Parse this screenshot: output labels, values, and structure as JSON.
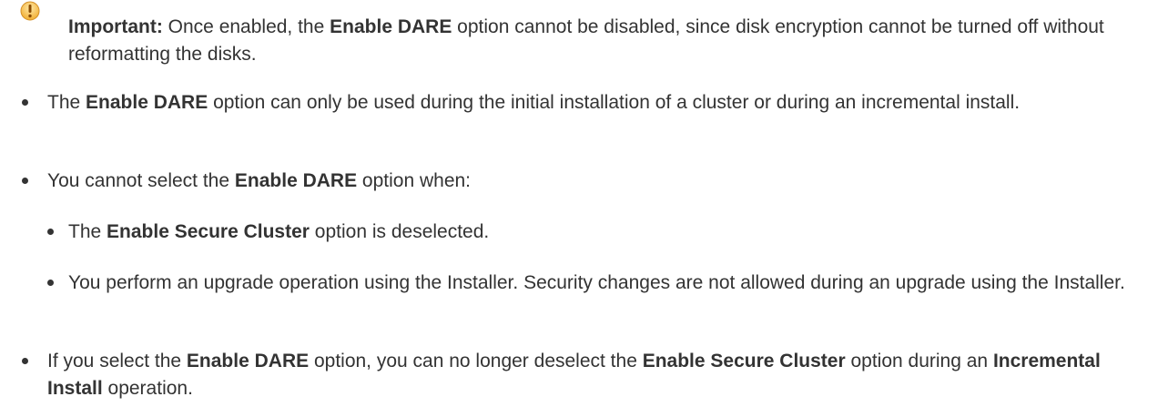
{
  "note": {
    "icon": "warning-icon",
    "icon_color": "#f2b23a",
    "label": "Important:",
    "text_parts": [
      " Once enabled, the ",
      "Enable DARE",
      " option cannot be disabled, since disk encryption cannot be turned off without reformatting the disks."
    ]
  },
  "bullets": [
    {
      "parts": [
        "The ",
        "Enable DARE",
        " option can only be used during the initial installation of a cluster or during an incremental install."
      ]
    },
    {
      "parts": [
        "You cannot select the ",
        "Enable DARE",
        " option when:"
      ],
      "sub": [
        {
          "parts": [
            "The ",
            "Enable Secure Cluster",
            " option is deselected."
          ]
        },
        {
          "parts": [
            "You perform an upgrade operation using the Installer. Security changes are not allowed during an upgrade using the Installer."
          ]
        }
      ]
    },
    {
      "parts": [
        "If you select the ",
        "Enable DARE",
        " option, you can no longer deselect the ",
        "Enable Secure Cluster",
        " option during an ",
        "Incremental Install",
        " operation."
      ]
    }
  ]
}
